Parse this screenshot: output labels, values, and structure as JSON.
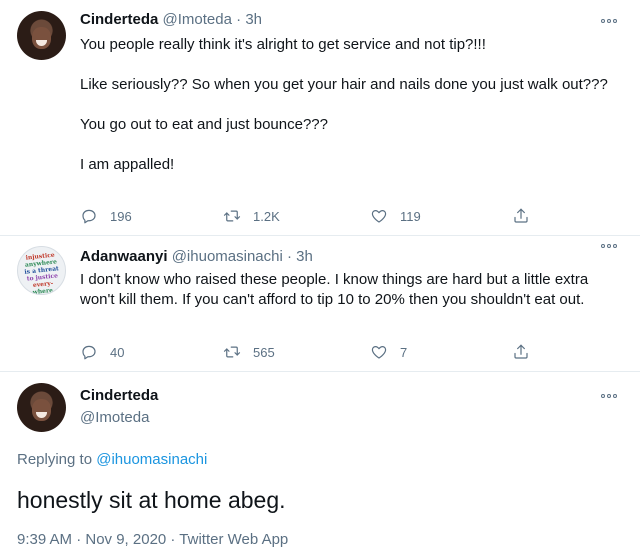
{
  "tweet1": {
    "name": "Cinderteda",
    "handle": "@Imoteda",
    "separator": "·",
    "time": "3h",
    "paragraphs": [
      "You people really think it's alright to get service and not tip?!!!",
      "Like seriously?? So when you get your hair and nails done you just walk out???",
      "You go out to eat and just bounce???",
      "I am appalled!"
    ],
    "replies": "196",
    "retweets": "1.2K",
    "likes": "119"
  },
  "tweet2": {
    "name": "Adanwaanyi",
    "handle": "@ihuomasinachi",
    "separator": "·",
    "time": "3h",
    "text": "I don't know who raised these people. I know things are hard but a little extra won't kill them. If you can't afford to tip 10 to 20% then you shouldn't eat out.",
    "replies": "40",
    "retweets": "565",
    "likes": "7",
    "avatar_text": [
      "injustice",
      "anywhere",
      "is a threat",
      "to justice",
      "every-",
      "where."
    ]
  },
  "tweet3": {
    "name": "Cinderteda",
    "handle": "@Imoteda",
    "replying_prefix": "Replying to",
    "replying_to": "@ihuomasinachi",
    "text": "honestly sit at home abeg.",
    "meta": "9:39 AM · Nov 9, 2020 · Twitter Web App"
  },
  "icons": {
    "reply": "reply-icon",
    "retweet": "retweet-icon",
    "like": "heart-icon",
    "share": "share-icon",
    "more": "more-options-icon"
  },
  "colors": {
    "text": "#0f1419",
    "muted": "#5b7083",
    "link": "#1b95e0",
    "divider": "#e6ecf0"
  }
}
